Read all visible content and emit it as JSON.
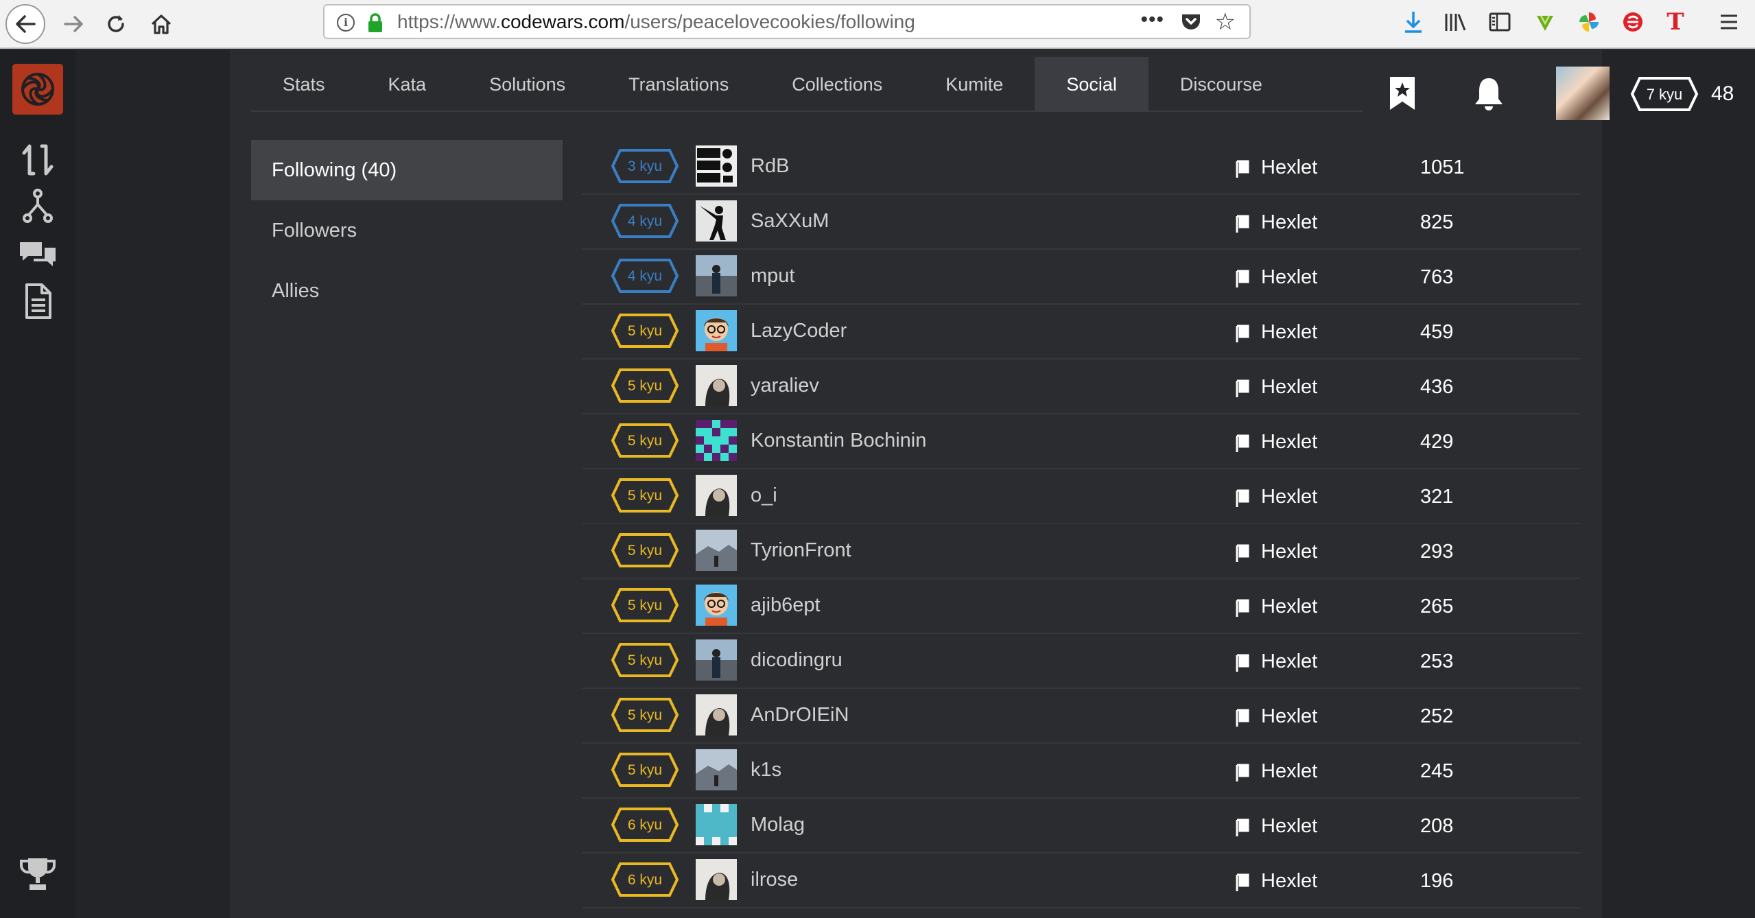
{
  "browser": {
    "url_prefix": "https://www.",
    "url_host": "codewars.com",
    "url_path": "/users/peacelovecookies/following"
  },
  "tabs": [
    {
      "label": "Stats"
    },
    {
      "label": "Kata"
    },
    {
      "label": "Solutions"
    },
    {
      "label": "Translations"
    },
    {
      "label": "Collections"
    },
    {
      "label": "Kumite"
    },
    {
      "label": "Social",
      "active": true
    },
    {
      "label": "Discourse"
    }
  ],
  "header": {
    "rank_label": "7 kyu",
    "honor": "48"
  },
  "side_menu": [
    {
      "label": "Following (40)",
      "active": true
    },
    {
      "label": "Followers"
    },
    {
      "label": "Allies"
    }
  ],
  "colors": {
    "rank_blue": "#3a7fc4",
    "rank_yellow": "#e8b923",
    "rank_white": "#ffffff"
  },
  "users": [
    {
      "rank": "3 kyu",
      "color": "blue",
      "name": "RdB",
      "clan": "Hexlet",
      "honor": "1051",
      "avatar": "eat-sleep-code-avatar"
    },
    {
      "rank": "4 kyu",
      "color": "blue",
      "name": "SaXXuM",
      "clan": "Hexlet",
      "honor": "825",
      "avatar": "silhouette-avatar"
    },
    {
      "rank": "4 kyu",
      "color": "blue",
      "name": "mput",
      "clan": "Hexlet",
      "honor": "763",
      "avatar": "photo-avatar"
    },
    {
      "rank": "5 kyu",
      "color": "yellow",
      "name": "LazyCoder",
      "clan": "Hexlet",
      "honor": "459",
      "avatar": "cartoon-avatar"
    },
    {
      "rank": "5 kyu",
      "color": "yellow",
      "name": "yaraliev",
      "clan": "Hexlet",
      "honor": "436",
      "avatar": "default-avatar"
    },
    {
      "rank": "5 kyu",
      "color": "yellow",
      "name": "Konstantin Bochinin",
      "clan": "Hexlet",
      "honor": "429",
      "avatar": "identicon-avatar"
    },
    {
      "rank": "5 kyu",
      "color": "yellow",
      "name": "o_i",
      "clan": "Hexlet",
      "honor": "321",
      "avatar": "default-avatar"
    },
    {
      "rank": "5 kyu",
      "color": "yellow",
      "name": "TyrionFront",
      "clan": "Hexlet",
      "honor": "293",
      "avatar": "landscape-avatar"
    },
    {
      "rank": "5 kyu",
      "color": "yellow",
      "name": "ajib6ept",
      "clan": "Hexlet",
      "honor": "265",
      "avatar": "cartoon-avatar"
    },
    {
      "rank": "5 kyu",
      "color": "yellow",
      "name": "dicodingru",
      "clan": "Hexlet",
      "honor": "253",
      "avatar": "photo-avatar"
    },
    {
      "rank": "5 kyu",
      "color": "yellow",
      "name": "AnDrOIEiN",
      "clan": "Hexlet",
      "honor": "252",
      "avatar": "default-avatar"
    },
    {
      "rank": "5 kyu",
      "color": "yellow",
      "name": "k1s",
      "clan": "Hexlet",
      "honor": "245",
      "avatar": "landscape-avatar"
    },
    {
      "rank": "6 kyu",
      "color": "yellow",
      "name": "Molag",
      "clan": "Hexlet",
      "honor": "208",
      "avatar": "pattern-avatar"
    },
    {
      "rank": "6 kyu",
      "color": "yellow",
      "name": "ilrose",
      "clan": "Hexlet",
      "honor": "196",
      "avatar": "default-avatar"
    }
  ]
}
